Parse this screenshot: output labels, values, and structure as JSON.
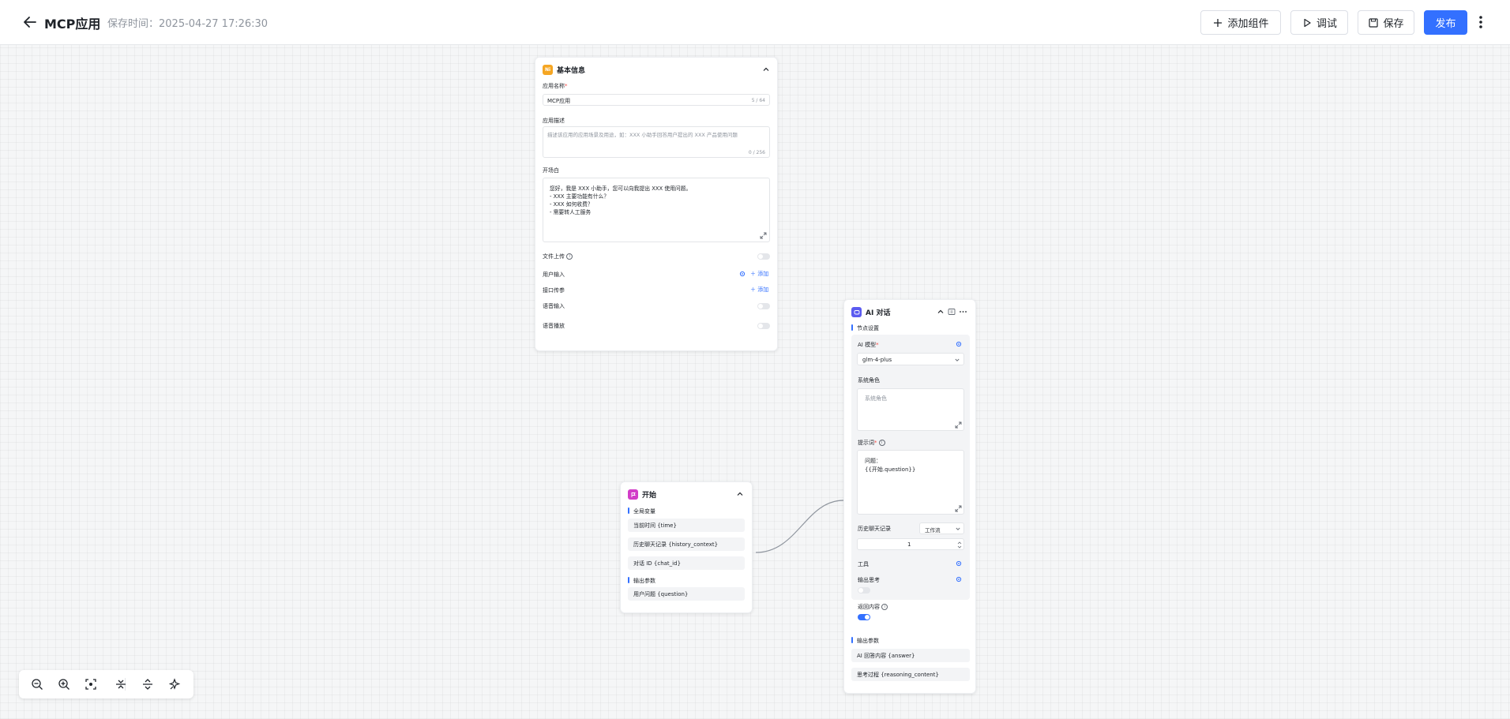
{
  "header": {
    "app_title": "MCP应用",
    "save_time": "保存时间：2025-04-27 17:26:30",
    "add_component_label": "添加组件",
    "debug_label": "调试",
    "save_label": "保存",
    "publish_label": "发布"
  },
  "colors": {
    "accent": "#3370ff",
    "base_icon": "#f5a623",
    "start_icon": "#d23cc8",
    "ai_icon": "#5b5bf0"
  },
  "base_node": {
    "icon_text": "Ni",
    "title": "基本信息",
    "name_label": "应用名称",
    "required_mark": "*",
    "name_value": "MCP应用",
    "name_count": "5 / 64",
    "desc_label": "应用描述",
    "desc_placeholder": "描述该应用的应用场景及用途，如：XXX 小助手回答用户提出的 XXX 产品使用问题",
    "desc_count": "0 / 256",
    "opening_label": "开场白",
    "opening_text": "您好，我是 XXX 小助手，您可以向我提出 XXX 使用问题。\n- XXX 主要功能有什么？\n- XXX 如何收费？\n- 需要转人工服务",
    "file_upload_label": "文件上传",
    "user_input_label": "用户输入",
    "user_input_add": "添加",
    "api_param_label": "接口传参",
    "api_param_add": "添加",
    "voice_input_label": "语音输入",
    "voice_play_label": "语音播放"
  },
  "start_node": {
    "title": "开始",
    "global_vars_label": "全局变量",
    "global_vars": [
      "当前时间 {time}",
      "历史聊天记录 {history_context}",
      "对话 ID {chat_id}"
    ],
    "output_label": "输出参数",
    "outputs": [
      "用户问题 {question}"
    ]
  },
  "ai_node": {
    "title": "AI 对话",
    "node_settings_label": "节点设置",
    "model_label": "AI 模型",
    "required_mark": "*",
    "model_value": "glm-4-plus",
    "system_role_label": "系统角色",
    "system_role_placeholder": "系统角色",
    "prompt_label": "提示词",
    "prompt_text": "问题：\n{{开始.question}}",
    "history_label": "历史聊天记录",
    "history_select": "工作流",
    "history_count": "1",
    "tools_label": "工具",
    "output_thinking_label": "输出思考",
    "return_content_label": "返回内容",
    "output_label": "输出参数",
    "outputs": [
      "AI 回答内容 {answer}",
      "思考过程 {reasoning_content}"
    ]
  },
  "zoom_bar": {
    "icons": [
      "zoom-out-icon",
      "zoom-in-icon",
      "fit-view-icon",
      "collapse-all-icon",
      "expand-all-icon",
      "beautify-icon"
    ]
  }
}
